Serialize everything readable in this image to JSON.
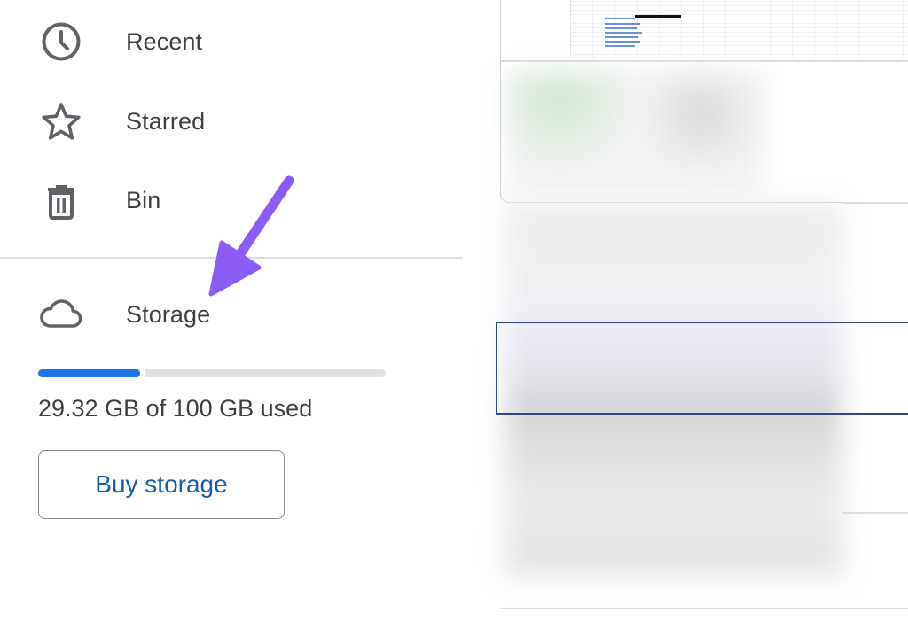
{
  "nav": {
    "items": [
      {
        "id": "recent",
        "label": "Recent",
        "icon": "clock-icon"
      },
      {
        "id": "starred",
        "label": "Starred",
        "icon": "star-icon"
      },
      {
        "id": "bin",
        "label": "Bin",
        "icon": "trash-icon"
      }
    ]
  },
  "storage": {
    "label": "Storage",
    "icon": "cloud-icon",
    "used_text": "29.32 GB of 100 GB used",
    "used_fraction": 0.2932,
    "buy_button_label": "Buy storage"
  },
  "colors": {
    "accent": "#1a73e8",
    "annotation_arrow": "#8b5cf6",
    "frame_border": "#a86ae0"
  }
}
